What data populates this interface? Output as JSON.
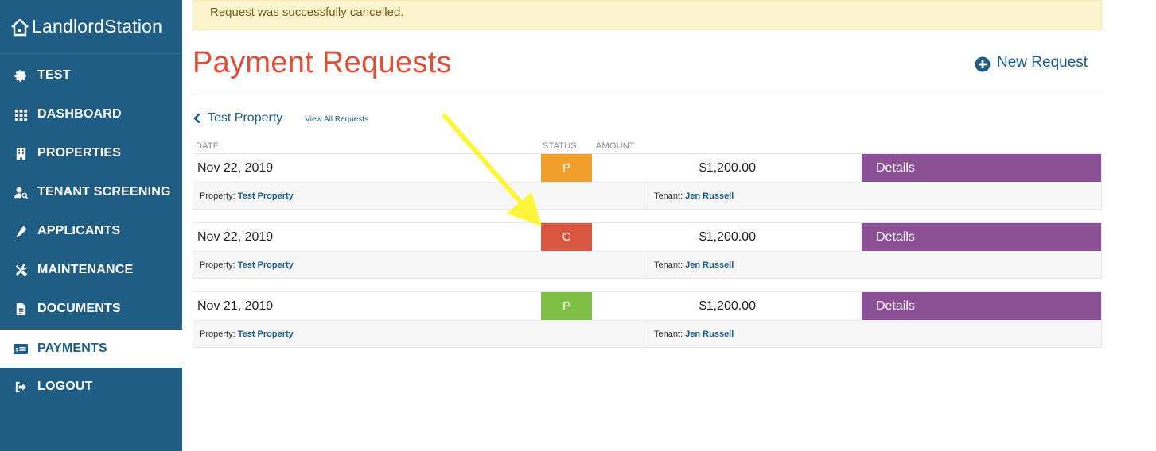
{
  "brand": {
    "name": "LandlordStation"
  },
  "sidebar": {
    "items": [
      {
        "label": "TEST",
        "icon": "gear-icon"
      },
      {
        "label": "DASHBOARD",
        "icon": "grid-icon"
      },
      {
        "label": "PROPERTIES",
        "icon": "building-icon"
      },
      {
        "label": "TENANT SCREENING",
        "icon": "user-search-icon"
      },
      {
        "label": "APPLICANTS",
        "icon": "pen-icon"
      },
      {
        "label": "MAINTENANCE",
        "icon": "tools-icon"
      },
      {
        "label": "DOCUMENTS",
        "icon": "document-icon"
      },
      {
        "label": "PAYMENTS",
        "icon": "payment-icon",
        "active": true
      },
      {
        "label": "LOGOUT",
        "icon": "logout-icon"
      }
    ]
  },
  "alert": {
    "message": "Request was successfully cancelled."
  },
  "page": {
    "title": "Payment Requests",
    "new_request_label": "New Request"
  },
  "breadcrumb": {
    "back_label": "Test Property",
    "view_all_label": "View All Requests"
  },
  "columns": {
    "date": "DATE",
    "status": "STATUS",
    "amount": "AMOUNT"
  },
  "requests": [
    {
      "date": "Nov 22, 2019",
      "status": "P",
      "status_color": "#f0a02a",
      "amount": "$1,200.00",
      "details_label": "Details",
      "property_label": "Property:",
      "property": "Test Property",
      "tenant_label": "Tenant:",
      "tenant": "Jen Russell"
    },
    {
      "date": "Nov 22, 2019",
      "status": "C",
      "status_color": "#da5640",
      "amount": "$1,200.00",
      "details_label": "Details",
      "property_label": "Property:",
      "property": "Test Property",
      "tenant_label": "Tenant:",
      "tenant": "Jen Russell"
    },
    {
      "date": "Nov 21, 2019",
      "status": "P",
      "status_color": "#7ebf45",
      "amount": "$1,200.00",
      "details_label": "Details",
      "property_label": "Property:",
      "property": "Test Property",
      "tenant_label": "Tenant:",
      "tenant": "Jen Russell"
    }
  ],
  "colors": {
    "sidebar": "#1f5d85",
    "title": "#d9503b",
    "details": "#8b5096",
    "arrow": "#fcf53a"
  }
}
